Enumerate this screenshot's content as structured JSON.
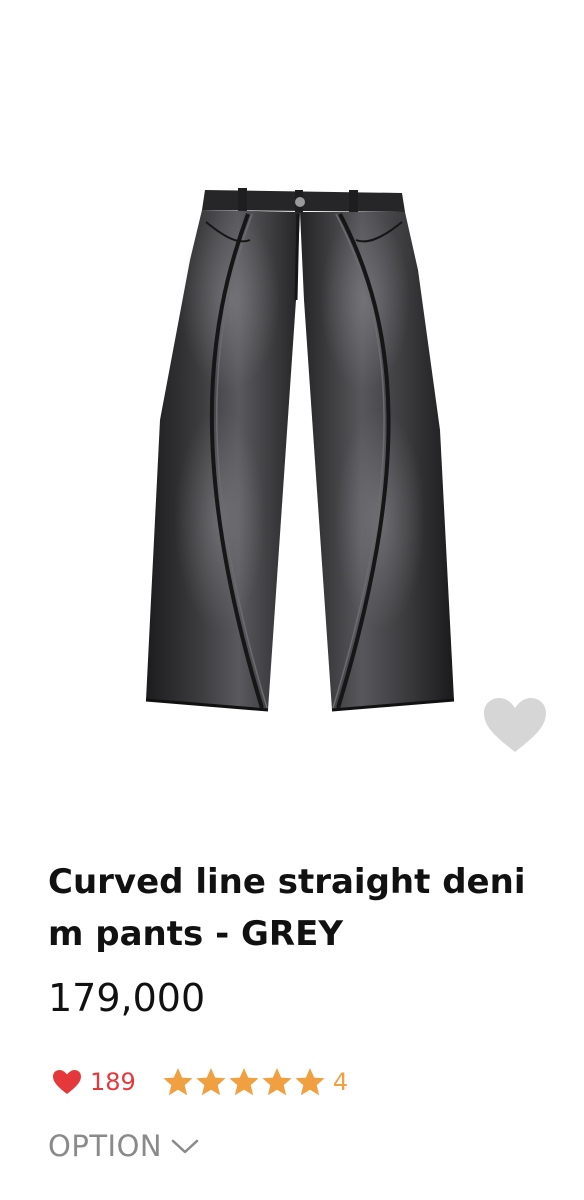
{
  "product": {
    "image_alt": "Black washed denim pants with curved seam lines",
    "title": "Curved line straight deni m pants - GREY",
    "price": "179,000"
  },
  "stats": {
    "likes": "189",
    "rating_stars": 5,
    "review_count": "4"
  },
  "option": {
    "label": "OPTION"
  },
  "icons": {
    "wish": "heart-icon",
    "likes": "heart-icon",
    "rating": "star-icon",
    "option_toggle": "chevron-down-icon"
  },
  "colors": {
    "likes_red": "#e5383b",
    "star_orange": "#f0a040",
    "wish_grey": "#d6d6d6",
    "option_grey": "#8a8a8a"
  }
}
